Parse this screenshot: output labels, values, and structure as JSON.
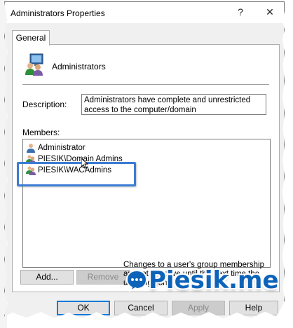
{
  "window": {
    "title": "Administrators Properties",
    "help_button": "?",
    "close_button": "✕"
  },
  "tabs": [
    {
      "label": "General",
      "selected": true
    }
  ],
  "group": {
    "name": "Administrators",
    "icon": "group-icon"
  },
  "description": {
    "label": "Description:",
    "value": "Administrators have complete and unrestricted access to the computer/domain"
  },
  "members": {
    "label": "Members:",
    "items": [
      {
        "name": "Administrator",
        "icon": "user-icon"
      },
      {
        "name": "PIESIK\\Domain Admins",
        "icon": "group-icon"
      },
      {
        "name": "PIESIK\\WACAdmins",
        "icon": "group-icon"
      }
    ]
  },
  "buttons": {
    "add": "Add...",
    "remove": "Remove",
    "ok": "OK",
    "cancel": "Cancel",
    "apply": "Apply",
    "help": "Help"
  },
  "note": "Changes to a user's group membership are not effective until the next time the user logs on.",
  "watermark": {
    "text": "Piesik.me",
    "color": "#0d63b9"
  },
  "colors": {
    "highlight": "#3c7cd4",
    "default_button": "#0078d7"
  }
}
